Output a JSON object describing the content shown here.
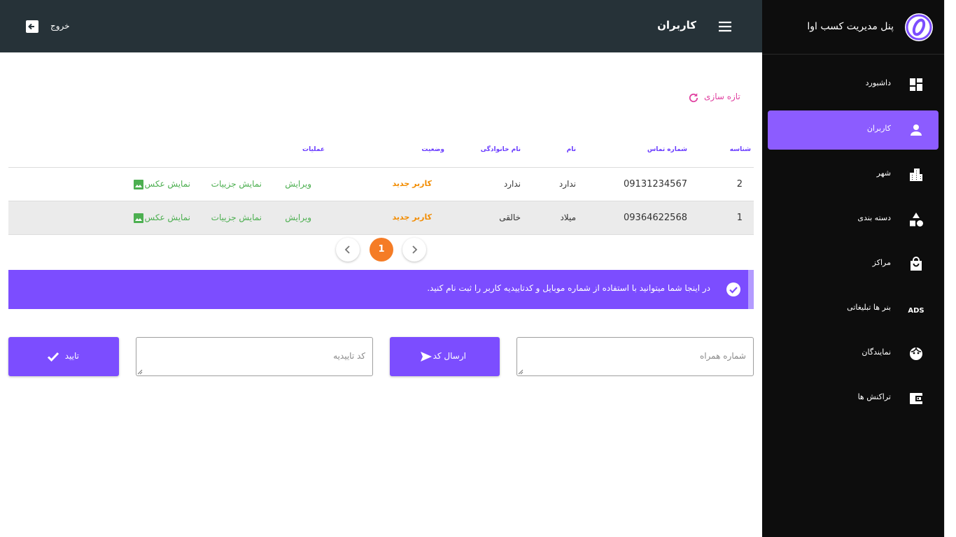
{
  "sidebar": {
    "brand_title": "پنل مدیریت کسب اوا",
    "brand_logo": "ava-logo-icon",
    "items": [
      {
        "label": "داشبورد",
        "icon": "dashboard-icon",
        "active": false
      },
      {
        "label": "کاربران",
        "icon": "user-icon",
        "active": true
      },
      {
        "label": "شهر",
        "icon": "city-icon",
        "active": false
      },
      {
        "label": "دسته بندی",
        "icon": "category-icon",
        "active": false
      },
      {
        "label": "مراکز",
        "icon": "shopping-bag-icon",
        "active": false
      },
      {
        "label": "بنر ها تبلیغاتی",
        "icon": "ads-icon",
        "active": false
      },
      {
        "label": "نمایندگان",
        "icon": "face-icon",
        "active": false
      },
      {
        "label": "تراکنش ها",
        "icon": "wallet-icon",
        "active": false
      }
    ]
  },
  "topbar": {
    "title": "کاربران",
    "logout_label": "خروج"
  },
  "refresh": {
    "label": "تازه سازی"
  },
  "table": {
    "headers": {
      "id": "شناسه",
      "phone": "شماره تماس",
      "name": "نام",
      "family": "نام خانوادگی",
      "status": "وضعیت",
      "actions": "عملیات"
    },
    "rows": [
      {
        "id": "2",
        "phone": "09131234567",
        "name": "ندارد",
        "family": "ندارد",
        "status": "کاربر جدید",
        "edit": "ویرایش",
        "details": "نمایش جزییات",
        "photo": "نمایش عکس"
      },
      {
        "id": "1",
        "phone": "09364622568",
        "name": "میلاد",
        "family": "خالقی",
        "status": "کاربر جدید",
        "edit": "ویرایش",
        "details": "نمایش جزییات",
        "photo": "نمایش عکس"
      }
    ]
  },
  "pagination": {
    "current": "1"
  },
  "info": {
    "text": "در اینجا شما میتوانید با استفاده از شماره موبایل و کدتاییدیه کاربر را ثبت نام کنید."
  },
  "form": {
    "phone_placeholder": "شماره همراه",
    "send_code_label": "ارسال کد",
    "code_placeholder": "کد تاییدیه",
    "confirm_label": "تایید"
  },
  "colors": {
    "accent": "#7c4dff",
    "active_nav": "#8c5cff",
    "topbar": "#263238",
    "status": "#f28c00",
    "action": "#4caf50",
    "page_current": "#f57c26"
  }
}
